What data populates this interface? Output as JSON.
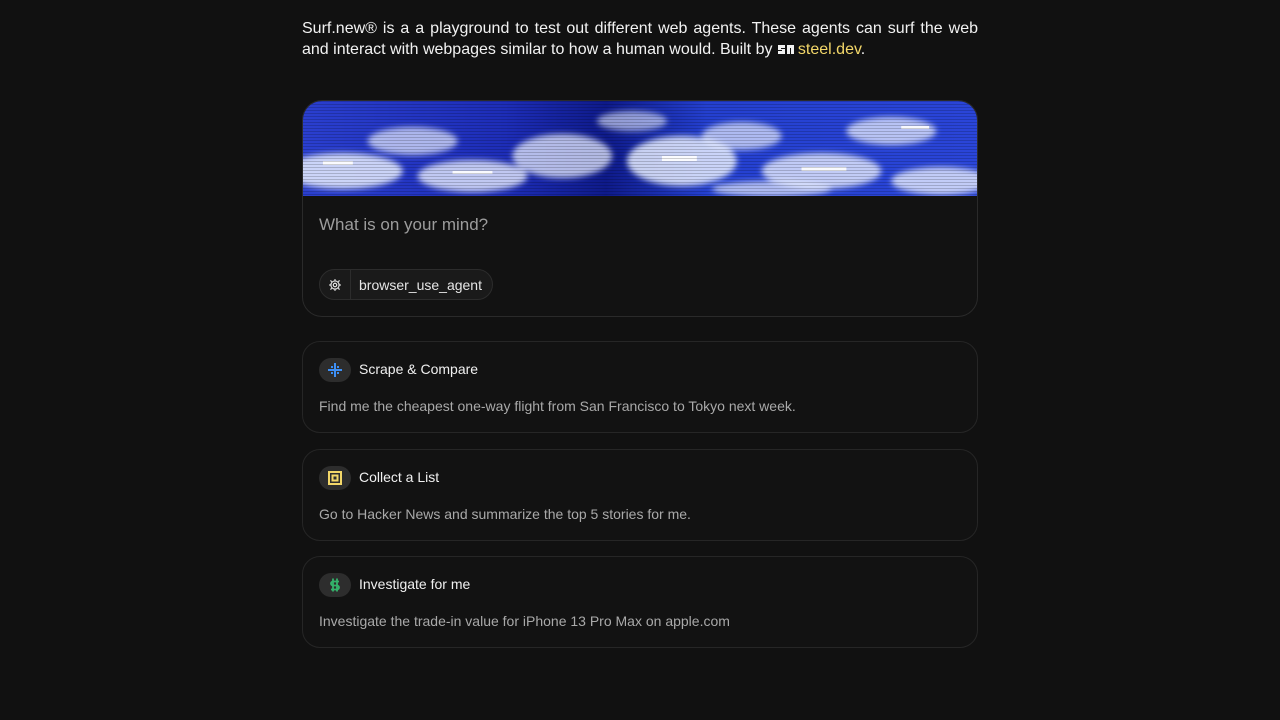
{
  "intro": {
    "text_before": "Surf.new® is a a playground to test out different web agents. These agents can surf the web and interact with webpages similar to how a human would. Built by ",
    "brand_link": "steel.dev",
    "text_after": ".",
    "brand_logo_icon": "steel-logo-icon"
  },
  "prompt": {
    "placeholder": "What is on your mind?",
    "agent_chip": {
      "icon": "gear-icon",
      "label": "browser_use_agent"
    }
  },
  "suggestions": [
    {
      "icon": "sparkle-arrows-icon",
      "icon_color": "#3d8ff5",
      "title": "Scrape & Compare",
      "description": "Find me the cheapest one-way flight from San Francisco to Tokyo next week."
    },
    {
      "icon": "list-box-icon",
      "icon_color": "#f3d769",
      "title": "Collect a List",
      "description": "Go to Hacker News and summarize the top 5 stories for me."
    },
    {
      "icon": "dollar-icon",
      "icon_color": "#34b36b",
      "title": "Investigate for me",
      "description": "Investigate the trade-in value for iPhone 13 Pro Max on apple.com"
    }
  ],
  "colors": {
    "background": "#111111",
    "accent_link": "#f3d769",
    "card_border": "#2a2a2a"
  }
}
